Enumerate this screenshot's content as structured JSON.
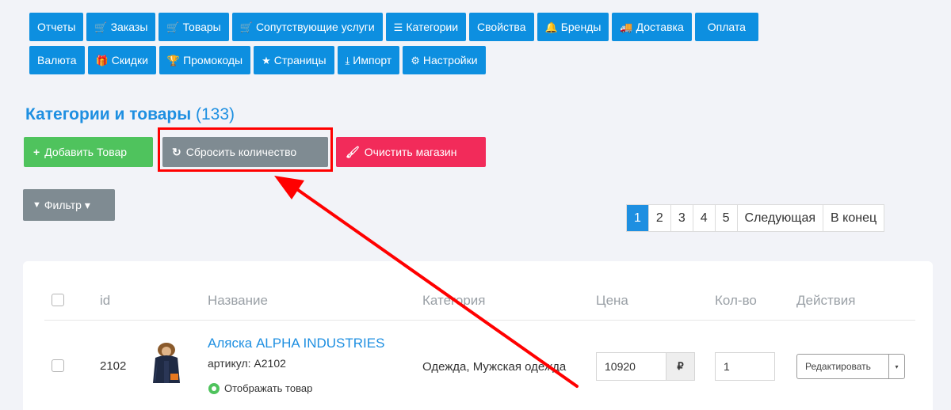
{
  "nav": {
    "row1": [
      {
        "label": "Отчеты",
        "icon": "",
        "icon_name": ""
      },
      {
        "label": "Заказы",
        "icon": "🛒",
        "icon_name": "cart-icon"
      },
      {
        "label": "Товары",
        "icon": "🛒",
        "icon_name": "cart-icon"
      },
      {
        "label": "Сопутствующие услуги",
        "icon": "🛒",
        "icon_name": "cart-plus-icon"
      },
      {
        "label": "Категории",
        "icon": "☰",
        "icon_name": "list-icon"
      },
      {
        "label": "Свойства",
        "icon": "",
        "icon_name": ""
      },
      {
        "label": "Бренды",
        "icon": "🔔",
        "icon_name": "bell-icon"
      },
      {
        "label": "Доставка",
        "icon": "🚚",
        "icon_name": "truck-icon"
      },
      {
        "label": "Оплата",
        "icon": "",
        "icon_name": ""
      }
    ],
    "row2": [
      {
        "label": "Валюта",
        "icon": "",
        "icon_name": ""
      },
      {
        "label": "Скидки",
        "icon": "🎁",
        "icon_name": "gift-icon"
      },
      {
        "label": "Промокоды",
        "icon": "🏆",
        "icon_name": "trophy-icon"
      },
      {
        "label": "Страницы",
        "icon": "★",
        "icon_name": "star-icon"
      },
      {
        "label": "Импорт",
        "icon": "⤓",
        "icon_name": "download-icon"
      },
      {
        "label": "Настройки",
        "icon": "⚙",
        "icon_name": "gear-icon"
      }
    ]
  },
  "page": {
    "title": "Категории и товары",
    "count": "(133)"
  },
  "actions": {
    "add": {
      "label": "Добавить Товар",
      "icon": "+"
    },
    "reset": {
      "label": "Сбросить количество",
      "icon": "↻"
    },
    "clear": {
      "label": "Очистить магазин",
      "icon": "🖌"
    }
  },
  "filter": {
    "label": "Фильтр",
    "icon": "▼",
    "caret": "▾"
  },
  "pagination": {
    "pages": [
      "1",
      "2",
      "3",
      "4",
      "5"
    ],
    "active": "1",
    "next": "Следующая",
    "last": "В конец"
  },
  "table": {
    "headers": {
      "id": "id",
      "name": "Название",
      "category": "Категория",
      "price": "Цена",
      "qty": "Кол-во",
      "actions": "Действия"
    },
    "rows": [
      {
        "id": "2102",
        "name": "Аляска ALPHA INDUSTRIES",
        "sku": "артикул: A2102",
        "visibility": "Отображать товар",
        "category": "Одежда, Мужская одежда",
        "price": "10920",
        "currency": "₽",
        "qty": "1",
        "edit": "Редактировать",
        "edit_caret": "▾"
      }
    ]
  },
  "colors": {
    "primary": "#0d8fe0",
    "success": "#4fc35d",
    "secondary": "#7f8b92",
    "danger": "#f22b5a",
    "highlight": "#ff0000"
  }
}
